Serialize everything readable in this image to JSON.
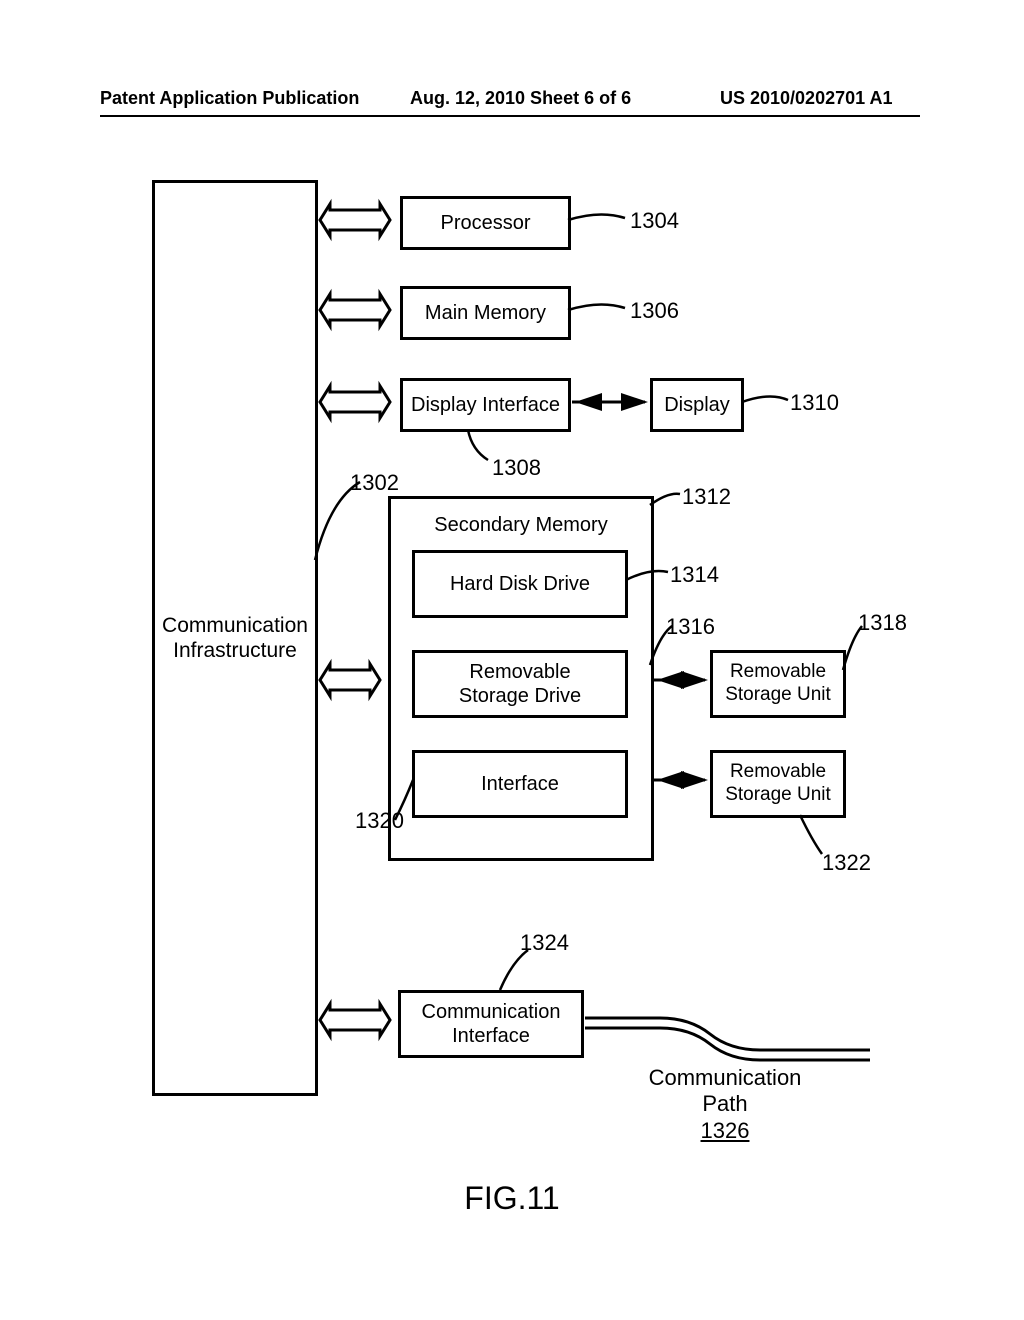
{
  "header": {
    "left": "Patent Application Publication",
    "center": "Aug. 12, 2010  Sheet 6 of 6",
    "right": "US 2010/0202701 A1"
  },
  "figure_label": "FIG.11",
  "blocks": {
    "comm_infra": "Communication\nInfrastructure",
    "processor": "Processor",
    "main_memory": "Main  Memory",
    "display_interface": "Display  Interface",
    "display": "Display",
    "secondary_memory": "Secondary  Memory",
    "hard_disk_drive": "Hard  Disk  Drive",
    "removable_storage_drive": "Removable\nStorage  Drive",
    "interface": "Interface",
    "removable_storage_unit_1": "Removable\nStorage Unit",
    "removable_storage_unit_2": "Removable\nStorage Unit",
    "comm_interface": "Communication\nInterface",
    "comm_path": "Communication\nPath",
    "comm_path_num": "1326"
  },
  "refs": {
    "r1302": "1302",
    "r1304": "1304",
    "r1306": "1306",
    "r1308": "1308",
    "r1310": "1310",
    "r1312": "1312",
    "r1314": "1314",
    "r1316": "1316",
    "r1318": "1318",
    "r1320": "1320",
    "r1322": "1322",
    "r1324": "1324"
  }
}
